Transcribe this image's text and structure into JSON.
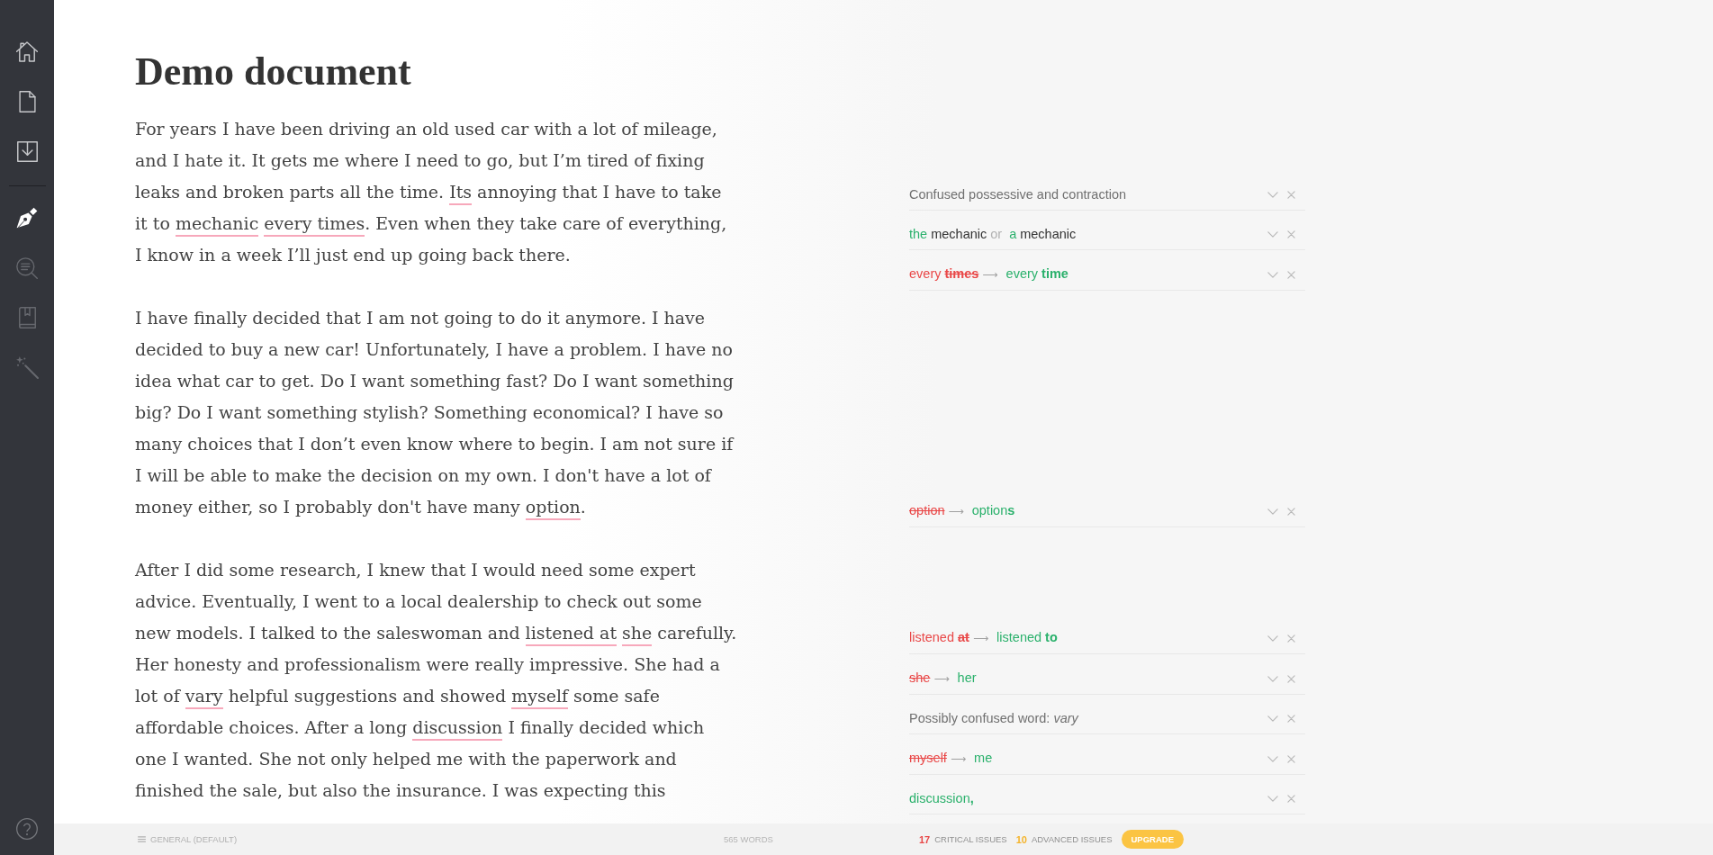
{
  "sidebar": {
    "tools": [
      {
        "selected": true
      },
      {
        "selected": false
      },
      {
        "selected": false
      },
      {
        "selected": false
      }
    ]
  },
  "document": {
    "title": "Demo document",
    "paragraphs": [
      {
        "segments": [
          {
            "text": "For years I have been driving an old used car with a lot of mileage, and I hate it. It gets me where I need to go, but I’m tired of fixing leaks and broken parts all the time. ",
            "flagged": false
          },
          {
            "text": "Its",
            "flagged": true
          },
          {
            "text": " annoying that I have to take it to ",
            "flagged": false
          },
          {
            "text": "mechanic ",
            "flagged": true
          },
          {
            "text": "every times",
            "flagged": true
          },
          {
            "text": ". Even when they take care of everything, I know in a week I’ll just end up going back there.",
            "flagged": false
          }
        ]
      },
      {
        "segments": [
          {
            "text": "I have finally decided that I am not going to do it anymore. I have decided to buy a new car! Unfortunately, I have a problem. I have no idea what car to get. Do I want something fast? Do I want something big? Do I want something stylish? Something economical? I have so many choices that I don’t even know where to begin. I am not sure if I will be able to make the decision on my own. I don't have a lot of money either, so I probably don't have many ",
            "flagged": false
          },
          {
            "text": "option",
            "flagged": true
          },
          {
            "text": ".",
            "flagged": false
          }
        ]
      },
      {
        "segments": [
          {
            "text": "After I did some research, I knew that I would need some expert advice. Eventually, I went to a local dealership to check out some new models. I talked to the saleswoman and ",
            "flagged": false
          },
          {
            "text": "listened at ",
            "flagged": true
          },
          {
            "text": "she",
            "flagged": true
          },
          {
            "text": " carefully. Her honesty and professionalism were really impressive. She had a lot of ",
            "flagged": false
          },
          {
            "text": "vary",
            "flagged": true
          },
          {
            "text": " helpful suggestions and showed ",
            "flagged": false
          },
          {
            "text": "myself",
            "flagged": true
          },
          {
            "text": " some safe affordable choices. After a long ",
            "flagged": false
          },
          {
            "text": "discussion",
            "flagged": true
          },
          {
            "text": " I finally decided which one I wanted. She not only helped me with the paperwork and finished the sale, but also the insurance. I was expecting this",
            "flagged": false
          }
        ]
      }
    ]
  },
  "issue_panel": {
    "groups": [
      {
        "cards": [
          {
            "parts": [
              {
                "kind": "message",
                "text": "Confused possessive and contraction"
              }
            ]
          },
          {
            "parts": [
              {
                "kind": "new",
                "text": "the"
              },
              {
                "kind": "context",
                "text": "mechanic"
              },
              {
                "kind": "separator",
                "text": "or"
              },
              {
                "kind": "new",
                "text": "a"
              },
              {
                "kind": "context",
                "text": "mechanic"
              }
            ]
          },
          {
            "parts": [
              {
                "kind": "old",
                "text": "every"
              },
              {
                "kind": "deleted_strong",
                "text": "times"
              },
              {
                "kind": "arrow",
                "text": "⟶"
              },
              {
                "kind": "new",
                "text": "every **time**"
              }
            ]
          }
        ]
      },
      {
        "cards": [
          {
            "parts": [
              {
                "kind": "deleted",
                "text": "option"
              },
              {
                "kind": "arrow",
                "text": "⟶"
              },
              {
                "kind": "new",
                "text": "option**s**"
              }
            ]
          }
        ]
      },
      {
        "cards": [
          {
            "parts": [
              {
                "kind": "old",
                "text": "listened"
              },
              {
                "kind": "deleted_strong",
                "text": "at"
              },
              {
                "kind": "arrow",
                "text": "⟶"
              },
              {
                "kind": "new",
                "text": "listened **to**"
              }
            ]
          },
          {
            "parts": [
              {
                "kind": "deleted",
                "text": "she"
              },
              {
                "kind": "arrow",
                "text": "⟶"
              },
              {
                "kind": "new",
                "text": "her"
              }
            ]
          },
          {
            "parts": [
              {
                "kind": "message",
                "text": "Possibly confused word: *vary*"
              }
            ]
          },
          {
            "parts": [
              {
                "kind": "deleted",
                "text": "myself"
              },
              {
                "kind": "arrow",
                "text": "⟶"
              },
              {
                "kind": "new",
                "text": "me"
              }
            ]
          },
          {
            "parts": [
              {
                "kind": "new",
                "text": "discussion**,**"
              }
            ]
          }
        ]
      }
    ]
  },
  "status_bar": {
    "goal_button": "GENERAL (DEFAULT)",
    "word_count": "565 WORDS",
    "issues": [
      {
        "count": "17",
        "label": "CRITICAL ISSUES",
        "color": "#e84848"
      },
      {
        "count": "10",
        "label": "ADVANCED ISSUES",
        "color": "#f4b42c"
      }
    ],
    "upgrade_button": "UPGRADE"
  }
}
